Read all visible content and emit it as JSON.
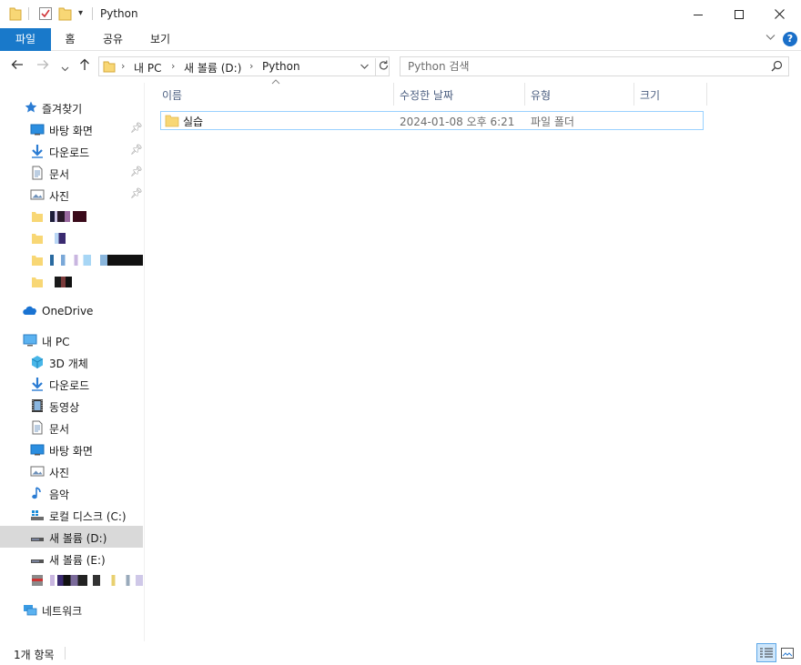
{
  "window": {
    "title": "Python"
  },
  "ribbon": {
    "tabs": [
      {
        "label": "파일"
      },
      {
        "label": "홈"
      },
      {
        "label": "공유"
      },
      {
        "label": "보기"
      }
    ],
    "help_label": "?"
  },
  "address": {
    "crumbs": [
      "내 PC",
      "새 볼륨 (D:)",
      "Python"
    ]
  },
  "search": {
    "placeholder": "Python 검색"
  },
  "nav": {
    "quick_access": "즐겨찾기",
    "quick_items": [
      {
        "label": "바탕 화면",
        "icon": "desktop-icon",
        "pinned": true
      },
      {
        "label": "다운로드",
        "icon": "download-icon",
        "pinned": true
      },
      {
        "label": "문서",
        "icon": "document-icon",
        "pinned": true
      },
      {
        "label": "사진",
        "icon": "pictures-icon",
        "pinned": true
      }
    ],
    "onedrive": "OneDrive",
    "this_pc": "내 PC",
    "pc_items": [
      {
        "label": "3D 개체",
        "icon": "3d-objects-icon"
      },
      {
        "label": "다운로드",
        "icon": "download-icon"
      },
      {
        "label": "동영상",
        "icon": "videos-icon"
      },
      {
        "label": "문서",
        "icon": "document-icon"
      },
      {
        "label": "바탕 화면",
        "icon": "desktop-icon"
      },
      {
        "label": "사진",
        "icon": "pictures-icon"
      },
      {
        "label": "음악",
        "icon": "music-icon"
      },
      {
        "label": "로컬 디스크 (C:)",
        "icon": "local-disk-icon"
      },
      {
        "label": "새 볼륨 (D:)",
        "icon": "drive-icon",
        "selected": true
      },
      {
        "label": "새 볼륨 (E:)",
        "icon": "drive-icon"
      }
    ],
    "network": "네트워크"
  },
  "columns": {
    "name": "이름",
    "modified": "수정한 날짜",
    "type": "유형",
    "size": "크기"
  },
  "files": [
    {
      "name": "실습",
      "modified": "2024-01-08 오후 6:21",
      "type": "파일 폴더",
      "size": ""
    }
  ],
  "status": {
    "item_count": "1개 항목"
  },
  "colors": {
    "accent": "#1979ca",
    "selected_nav": "#d9d9d9",
    "selected_row_border": "#99d1ff",
    "header_text": "#4d6082",
    "folder": "#f8d775"
  }
}
